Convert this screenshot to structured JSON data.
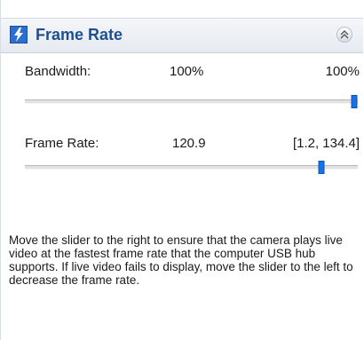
{
  "header": {
    "title": "Frame Rate"
  },
  "bandwidth": {
    "label": "Bandwidth:",
    "value": "100%",
    "range": "100%",
    "level": 1.0
  },
  "frame_rate": {
    "label": "Frame Rate:",
    "value": "120.9",
    "range": "[1.2, 134.4]",
    "current": 120.9,
    "min": 1.2,
    "max": 134.4
  },
  "description": "Move the slider to the right to ensure that the camera plays live video at the fastest frame rate that the computer USB hub supports. If live video fails to display, move the slider to the left to decrease the frame rate.",
  "colors": {
    "title": "#1d4f91",
    "thumb": "#1672e6",
    "icon_bg": "#2a6fd1"
  },
  "icons": {
    "header": "lightning-icon",
    "collapse": "double-chevron-up-icon"
  }
}
